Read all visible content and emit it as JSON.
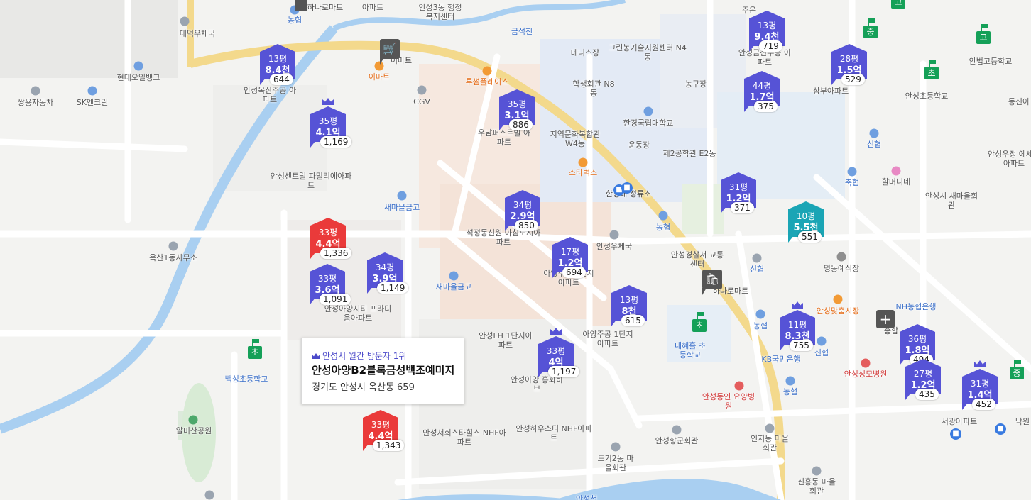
{
  "popup": {
    "rank": "안성시 월간 방문자 1위",
    "name": "안성아양B2블록금성백조예미지",
    "address": "경기도 안성시 옥산동 659"
  },
  "labels": [
    "하나로마트",
    "아파트",
    "안성3동 행정복지센터",
    "농협",
    "대덕우체국",
    "금석천",
    "주은",
    "현대오일뱅크",
    "이마트",
    "이마트",
    "투썸플레이스",
    "테니스장",
    "그린농기술지원센터 N4동",
    "쌍용자동차",
    "SK엔크린",
    "안성옥산주공 아파트",
    "CGV",
    "우남퍼스트빌 아파트",
    "학생회관 N8동",
    "농구장",
    "안성금산주공 아파트",
    "삼부아파트",
    "안법고등학교",
    "안성초등학교",
    "동신아",
    "한경국립대학교",
    "지역문화복합관 W4동",
    "운동장",
    "스타벅스",
    "제2공학관 E2동",
    "안성센트럴 파밀리에아파트",
    "신협",
    "안성우정 에세르아파트",
    "한경대 정류소",
    "축협",
    "할머니네",
    "안성시 새마을회관",
    "새마을금고",
    "석정동신원 아침도시아파트",
    "농협",
    "안성우체국",
    "옥산1동사무소",
    "아양주공 2단지아파트",
    "안성경찰서 교통센터",
    "신협",
    "명동예식장",
    "안성아양시티 프라디움아파트",
    "새마을금고",
    "하나로마트",
    "안성맞춤시장",
    "NH농협은행",
    "아양주공 1단지아파트",
    "안성LH 1단지아파트",
    "내혜홀 초등학교",
    "농협",
    "종합",
    "백성초등학교",
    "KB국민은행",
    "신협",
    "안성성모병원",
    "안성아양 흥화하브",
    "알미산공원",
    "안성동인 요양병원",
    "농협",
    "서광아파트",
    "낙원",
    "안성서희스타힐스 NHF아파트",
    "안성하우스디 NHF아파트",
    "안성향군회관",
    "인지동 마을회관",
    "도기2동 마을회관",
    "신흥동 마을회관",
    "안성천"
  ],
  "markers": [
    {
      "size": "13평",
      "price": "8.4천",
      "units": "644",
      "color": "blue"
    },
    {
      "size": "35평",
      "price": "4.1억",
      "units": "1,169",
      "color": "blue",
      "crown": true
    },
    {
      "size": "35평",
      "price": "3.1억",
      "units": "886",
      "color": "blue"
    },
    {
      "size": "13평",
      "price": "9.4천",
      "units": "719",
      "color": "blue"
    },
    {
      "size": "28평",
      "price": "1.5억",
      "units": "529",
      "color": "blue"
    },
    {
      "size": "44평",
      "price": "1.7억",
      "units": "375",
      "color": "blue"
    },
    {
      "size": "34평",
      "price": "2.9억",
      "units": "850",
      "color": "blue"
    },
    {
      "size": "31평",
      "price": "1.2억",
      "units": "371",
      "color": "blue"
    },
    {
      "size": "10평",
      "price": "5.5천",
      "units": "551",
      "color": "teal"
    },
    {
      "size": "33평",
      "price": "4.4억",
      "units": "1,336",
      "color": "red"
    },
    {
      "size": "17평",
      "price": "1.2억",
      "units": "694",
      "color": "blue"
    },
    {
      "size": "33평",
      "price": "3.6억",
      "units": "1,091",
      "color": "blue"
    },
    {
      "size": "34평",
      "price": "3.9억",
      "units": "1,149",
      "color": "blue"
    },
    {
      "size": "13평",
      "price": "8천",
      "units": "615",
      "color": "blue"
    },
    {
      "size": "11평",
      "price": "8.3천",
      "units": "755",
      "color": "blue",
      "crown": true
    },
    {
      "size": "36평",
      "price": "1.8억",
      "units": "494",
      "color": "blue"
    },
    {
      "size": "33평",
      "price": "4억",
      "units": "1,197",
      "color": "blue",
      "crown": true
    },
    {
      "size": "27평",
      "price": "1.2억",
      "units": "435",
      "color": "blue"
    },
    {
      "size": "31평",
      "price": "1.4억",
      "units": "452",
      "color": "blue",
      "crown": true
    },
    {
      "size": "33평",
      "price": "4.4억",
      "units": "1,343",
      "color": "red"
    }
  ],
  "schools": [
    "초",
    "초",
    "초",
    "중",
    "중",
    "고",
    "고"
  ],
  "stores": [
    "이마트",
    "하나로마트"
  ]
}
